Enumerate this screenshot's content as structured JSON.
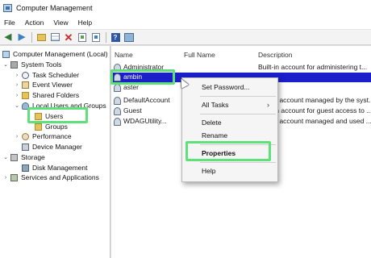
{
  "window": {
    "title": "Computer Management"
  },
  "menu": [
    "File",
    "Action",
    "View",
    "Help"
  ],
  "toolbar": {
    "buttons": [
      "back-arrow-icon",
      "forward-arrow-icon",
      "up-folder-icon",
      "show-hide-tree-icon",
      "delete-icon",
      "properties-icon",
      "export-list-icon",
      "help-icon",
      "console-icon"
    ],
    "help_glyph": "?"
  },
  "tree": {
    "root": "Computer Management (Local)",
    "system_tools": "System Tools",
    "task_scheduler": "Task Scheduler",
    "event_viewer": "Event Viewer",
    "shared_folders": "Shared Folders",
    "local_users_groups": "Local Users and Groups",
    "users": "Users",
    "groups": "Groups",
    "performance": "Performance",
    "device_manager": "Device Manager",
    "storage": "Storage",
    "disk_management": "Disk Management",
    "services_apps": "Services and Applications"
  },
  "list": {
    "columns": {
      "name": "Name",
      "full_name": "Full Name",
      "description": "Description"
    },
    "rows": [
      {
        "name": "Administrator",
        "description": "Built-in account for administering t..."
      },
      {
        "name": "ambin",
        "description": ""
      },
      {
        "name": "aster",
        "description": ""
      },
      {
        "name": "DefaultAccount",
        "description": "A user account managed by the syst..."
      },
      {
        "name": "Guest",
        "description": "Built-in account for guest access to ..."
      },
      {
        "name": "WDAGUtility...",
        "description": "A user account managed and used ..."
      }
    ]
  },
  "context_menu": {
    "set_password": "Set Password...",
    "all_tasks": "All Tasks",
    "all_tasks_arrow": "›",
    "delete": "Delete",
    "rename": "Rename",
    "properties": "Properties",
    "help": "Help"
  },
  "colors": {
    "highlight": "#5ee07a",
    "selection": "#1a1fc9"
  }
}
